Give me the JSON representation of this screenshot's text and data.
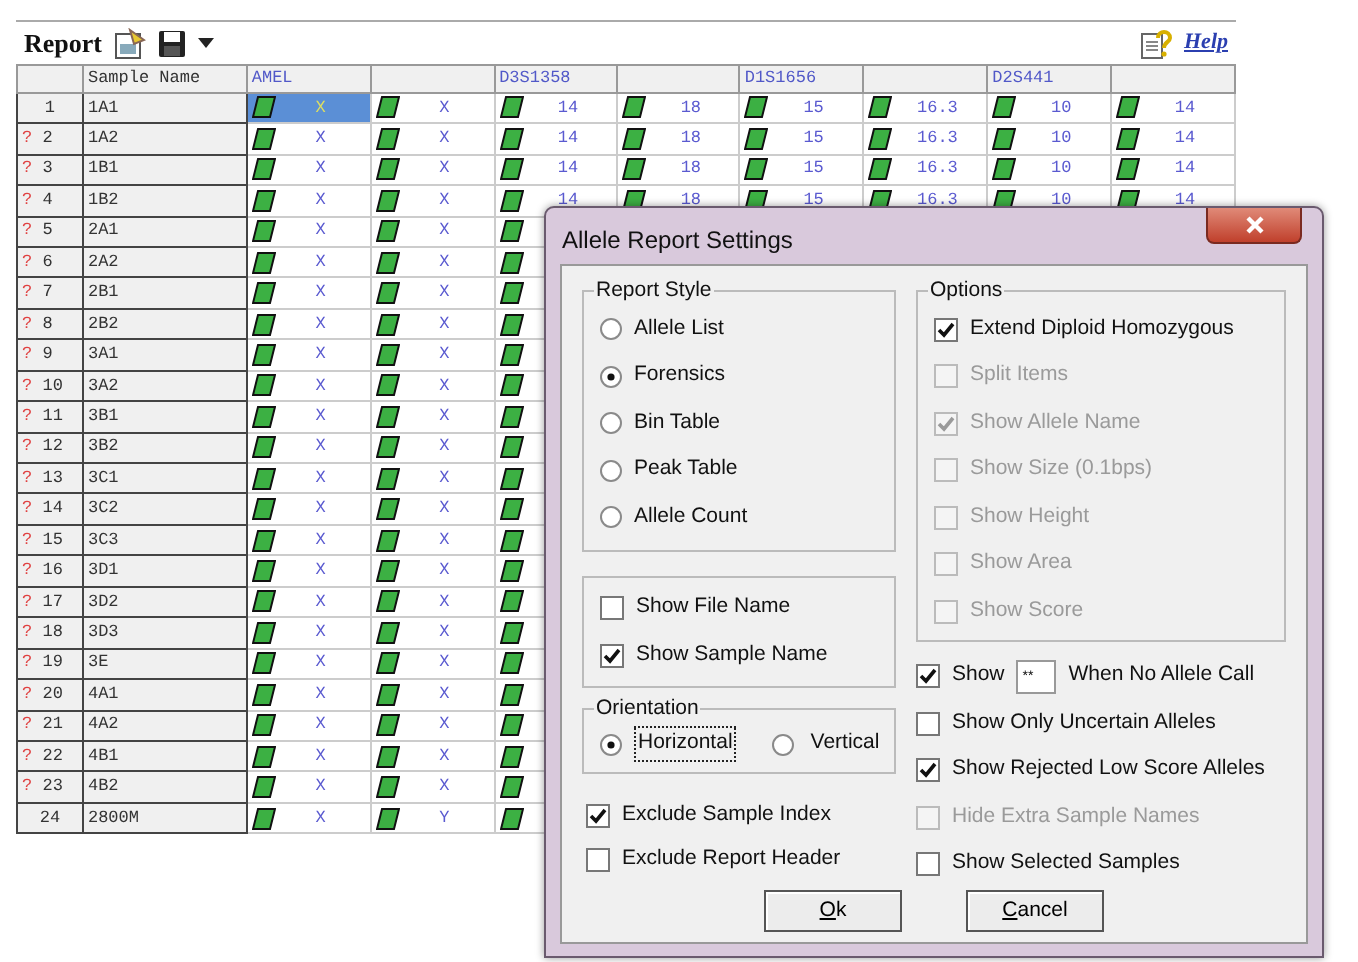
{
  "report": {
    "title": "Report",
    "help_link": "Help",
    "columns": {
      "sample": "Sample Name"
    },
    "loci": [
      {
        "name": "AMEL"
      },
      {
        "name": "D3S1358"
      },
      {
        "name": "D1S1656"
      },
      {
        "name": "D2S441"
      }
    ],
    "rows": [
      {
        "index": "1",
        "sample": "1A1",
        "cells": [
          {
            "kind": "call",
            "value": "X",
            "selected": true
          },
          {
            "kind": "call",
            "value": "X",
            "selected": false
          },
          {
            "kind": "call",
            "value": "14",
            "selected": false
          },
          {
            "kind": "call",
            "value": "18",
            "selected": false
          },
          {
            "kind": "call",
            "value": "15",
            "selected": false
          },
          {
            "kind": "call",
            "value": "16.3",
            "selected": false
          },
          {
            "kind": "call",
            "value": "10",
            "selected": false
          },
          {
            "kind": "call",
            "value": "14",
            "selected": false
          }
        ]
      },
      {
        "flag": "?",
        "index": "2",
        "sample": "1A2",
        "cells": [
          {
            "kind": "call",
            "value": "X",
            "selected": false
          },
          {
            "kind": "call",
            "value": "X",
            "selected": false
          },
          {
            "kind": "call",
            "value": "14",
            "selected": false
          },
          {
            "kind": "call",
            "value": "18",
            "selected": false
          },
          {
            "kind": "call",
            "value": "15",
            "selected": false
          },
          {
            "kind": "call",
            "value": "16.3",
            "selected": false
          },
          {
            "kind": "call",
            "value": "10",
            "selected": false
          },
          {
            "kind": "call",
            "value": "14",
            "selected": false
          }
        ]
      },
      {
        "flag": "?",
        "index": "3",
        "sample": "1B1",
        "cells": [
          {
            "kind": "call",
            "value": "X",
            "selected": false
          },
          {
            "kind": "call",
            "value": "X",
            "selected": false
          },
          {
            "kind": "call",
            "value": "14",
            "selected": false
          },
          {
            "kind": "call",
            "value": "18",
            "selected": false
          },
          {
            "kind": "call",
            "value": "15",
            "selected": false
          },
          {
            "kind": "call",
            "value": "16.3",
            "selected": false
          },
          {
            "kind": "call",
            "value": "10",
            "selected": false
          },
          {
            "kind": "call",
            "value": "14",
            "selected": false
          }
        ]
      },
      {
        "flag": "?",
        "index": "4",
        "sample": "1B2",
        "cells": [
          {
            "kind": "call",
            "value": "X",
            "selected": false
          },
          {
            "kind": "call",
            "value": "X",
            "selected": false
          },
          {
            "kind": "call",
            "value": "14",
            "selected": false
          },
          {
            "kind": "call",
            "value": "18",
            "selected": false
          },
          {
            "kind": "call",
            "value": "15",
            "selected": false
          },
          {
            "kind": "call",
            "value": "16.3",
            "selected": false
          },
          {
            "kind": "call",
            "value": "10",
            "selected": false
          },
          {
            "kind": "call",
            "value": "14",
            "selected": false
          }
        ]
      },
      {
        "flag": "?",
        "index": "5",
        "sample": "2A1",
        "cells": [
          {
            "kind": "call",
            "value": "X",
            "selected": false
          },
          {
            "kind": "call",
            "value": "X",
            "selected": false
          },
          {
            "kind": "icon"
          }
        ]
      },
      {
        "flag": "?",
        "index": "6",
        "sample": "2A2",
        "cells": [
          {
            "kind": "call",
            "value": "X",
            "selected": false
          },
          {
            "kind": "call",
            "value": "X",
            "selected": false
          },
          {
            "kind": "icon"
          }
        ]
      },
      {
        "flag": "?",
        "index": "7",
        "sample": "2B1",
        "cells": [
          {
            "kind": "call",
            "value": "X",
            "selected": false
          },
          {
            "kind": "call",
            "value": "X",
            "selected": false
          },
          {
            "kind": "icon"
          }
        ]
      },
      {
        "flag": "?",
        "index": "8",
        "sample": "2B2",
        "cells": [
          {
            "kind": "call",
            "value": "X",
            "selected": false
          },
          {
            "kind": "call",
            "value": "X",
            "selected": false
          },
          {
            "kind": "icon"
          }
        ]
      },
      {
        "flag": "?",
        "index": "9",
        "sample": "3A1",
        "cells": [
          {
            "kind": "call",
            "value": "X",
            "selected": false
          },
          {
            "kind": "call",
            "value": "X",
            "selected": false
          },
          {
            "kind": "icon"
          }
        ]
      },
      {
        "flag": "?",
        "index": "10",
        "sample": "3A2",
        "cells": [
          {
            "kind": "call",
            "value": "X",
            "selected": false
          },
          {
            "kind": "call",
            "value": "X",
            "selected": false
          },
          {
            "kind": "icon"
          }
        ]
      },
      {
        "flag": "?",
        "index": "11",
        "sample": "3B1",
        "cells": [
          {
            "kind": "call",
            "value": "X",
            "selected": false
          },
          {
            "kind": "call",
            "value": "X",
            "selected": false
          },
          {
            "kind": "icon"
          }
        ]
      },
      {
        "flag": "?",
        "index": "12",
        "sample": "3B2",
        "cells": [
          {
            "kind": "call",
            "value": "X",
            "selected": false
          },
          {
            "kind": "call",
            "value": "X",
            "selected": false
          },
          {
            "kind": "icon"
          }
        ]
      },
      {
        "flag": "?",
        "index": "13",
        "sample": "3C1",
        "cells": [
          {
            "kind": "call",
            "value": "X",
            "selected": false
          },
          {
            "kind": "call",
            "value": "X",
            "selected": false
          },
          {
            "kind": "icon"
          }
        ]
      },
      {
        "flag": "?",
        "index": "14",
        "sample": "3C2",
        "cells": [
          {
            "kind": "call",
            "value": "X",
            "selected": false
          },
          {
            "kind": "call",
            "value": "X",
            "selected": false
          },
          {
            "kind": "icon"
          }
        ]
      },
      {
        "flag": "?",
        "index": "15",
        "sample": "3C3",
        "cells": [
          {
            "kind": "call",
            "value": "X",
            "selected": false
          },
          {
            "kind": "call",
            "value": "X",
            "selected": false
          },
          {
            "kind": "icon"
          }
        ]
      },
      {
        "flag": "?",
        "index": "16",
        "sample": "3D1",
        "cells": [
          {
            "kind": "call",
            "value": "X",
            "selected": false
          },
          {
            "kind": "call",
            "value": "X",
            "selected": false
          },
          {
            "kind": "icon"
          }
        ]
      },
      {
        "flag": "?",
        "index": "17",
        "sample": "3D2",
        "cells": [
          {
            "kind": "call",
            "value": "X",
            "selected": false
          },
          {
            "kind": "call",
            "value": "X",
            "selected": false
          },
          {
            "kind": "icon"
          }
        ]
      },
      {
        "flag": "?",
        "index": "18",
        "sample": "3D3",
        "cells": [
          {
            "kind": "call",
            "value": "X",
            "selected": false
          },
          {
            "kind": "call",
            "value": "X",
            "selected": false
          },
          {
            "kind": "icon"
          }
        ]
      },
      {
        "flag": "?",
        "index": "19",
        "sample": "3E",
        "cells": [
          {
            "kind": "call",
            "value": "X",
            "selected": false
          },
          {
            "kind": "call",
            "value": "X",
            "selected": false
          },
          {
            "kind": "icon"
          }
        ]
      },
      {
        "flag": "?",
        "index": "20",
        "sample": "4A1",
        "cells": [
          {
            "kind": "call",
            "value": "X",
            "selected": false
          },
          {
            "kind": "call",
            "value": "X",
            "selected": false
          },
          {
            "kind": "icon"
          }
        ]
      },
      {
        "flag": "?",
        "index": "21",
        "sample": "4A2",
        "cells": [
          {
            "kind": "call",
            "value": "X",
            "selected": false
          },
          {
            "kind": "call",
            "value": "X",
            "selected": false
          },
          {
            "kind": "icon"
          }
        ]
      },
      {
        "flag": "?",
        "index": "22",
        "sample": "4B1",
        "cells": [
          {
            "kind": "call",
            "value": "X",
            "selected": false
          },
          {
            "kind": "call",
            "value": "X",
            "selected": false
          },
          {
            "kind": "icon"
          }
        ]
      },
      {
        "flag": "?",
        "index": "23",
        "sample": "4B2",
        "cells": [
          {
            "kind": "call",
            "value": "X",
            "selected": false
          },
          {
            "kind": "call",
            "value": "X",
            "selected": false
          },
          {
            "kind": "icon"
          }
        ]
      },
      {
        "index": "24",
        "sample": "2800M",
        "cells": [
          {
            "kind": "call",
            "value": "X",
            "selected": false
          },
          {
            "kind": "call",
            "value": "Y",
            "selected": false
          },
          {
            "kind": "icon"
          }
        ]
      }
    ]
  },
  "dialog": {
    "title": "Allele Report Settings",
    "report_style": {
      "label": "Report Style",
      "options": [
        {
          "label": "Allele List",
          "selected": false
        },
        {
          "label": "Forensics",
          "selected": true
        },
        {
          "label": "Bin Table",
          "selected": false
        },
        {
          "label": "Peak Table",
          "selected": false
        },
        {
          "label": "Allele Count",
          "selected": false
        }
      ]
    },
    "name_options": [
      {
        "label": "Show File Name",
        "checked": false
      },
      {
        "label": "Show Sample Name",
        "checked": true
      }
    ],
    "orientation": {
      "label": "Orientation",
      "options": [
        {
          "label": "Horizontal",
          "selected": true,
          "focused": true
        },
        {
          "label": "Vertical",
          "selected": false,
          "focused": false
        }
      ]
    },
    "exclude_options": [
      {
        "label": "Exclude Sample Index",
        "checked": true
      },
      {
        "label": "Exclude Report Header",
        "checked": false
      }
    ],
    "options": {
      "label": "Options",
      "items": [
        {
          "label": "Extend Diploid Homozygous",
          "checked": true,
          "disabled": false
        },
        {
          "label": "Split Items",
          "checked": false,
          "disabled": true
        },
        {
          "label": "Show Allele Name",
          "checked": true,
          "disabled": true
        },
        {
          "label": "Show Size (0.1bps)",
          "checked": false,
          "disabled": true
        },
        {
          "label": "Show Height",
          "checked": false,
          "disabled": true
        },
        {
          "label": "Show Area",
          "checked": false,
          "disabled": true
        },
        {
          "label": "Show Score",
          "checked": false,
          "disabled": true
        }
      ]
    },
    "extra_options": [
      {
        "kind": "field",
        "label": "Show",
        "field_value": "**",
        "suffix": "When No Allele Call",
        "checked": true,
        "disabled": false
      },
      {
        "kind": "check",
        "label": "Show Only Uncertain Alleles",
        "checked": false,
        "disabled": false
      },
      {
        "kind": "check",
        "label": "Show Rejected Low Score Alleles",
        "checked": true,
        "disabled": false
      },
      {
        "kind": "check",
        "label": "Hide Extra Sample Names",
        "checked": false,
        "disabled": true
      },
      {
        "kind": "check",
        "label": "Show Selected Samples",
        "checked": false,
        "disabled": false
      }
    ],
    "buttons": [
      {
        "label": "Ok"
      },
      {
        "label": "Cancel"
      }
    ]
  }
}
